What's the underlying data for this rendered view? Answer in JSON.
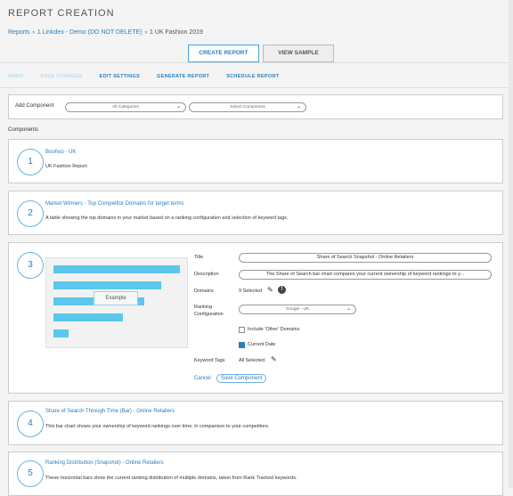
{
  "page": {
    "title": "REPORT CREATION"
  },
  "breadcrumb": {
    "part1": "Reports",
    "part2": "1 Linkdex - Demo (DO NOT DELETE)",
    "part3": "1 UK Fashion 2019"
  },
  "tabs": [
    {
      "label": "CREATE REPORT"
    },
    {
      "label": "VIEW SAMPLE"
    }
  ],
  "toolbar": {
    "undo": "UNDO",
    "save": "SAVE CHANGES",
    "edit": "EDIT SETTINGS",
    "generate": "GENERATE REPORT",
    "schedule": "SCHEDULE REPORT"
  },
  "add_component": {
    "label": "Add Component",
    "categories": "All Categories",
    "components": "Select Component"
  },
  "components_label": "Components",
  "cards": [
    {
      "num": "1",
      "title": "Boohoo - UK",
      "desc": "UK Fashion Report"
    },
    {
      "num": "2",
      "title": "Market Winners - Top Competitor Domains for target terms",
      "desc": "A table showing the top domains in your market based on a ranking configuration and selection of keyword tags."
    },
    {
      "num": "3",
      "example": "Example",
      "form": {
        "title_label": "Title",
        "title_value": "Share of Search Snapshot - Online Retailers",
        "description_label": "Description",
        "description_value": "The Share of Search bar chart compares your current ownership of keyword rankings to y...",
        "domains_label": "Domains",
        "domains_value": "9 Selected",
        "ranking_label_1": "Ranking",
        "ranking_label_2": "Configuration",
        "ranking_value": "Google - UK",
        "include_other": "Include 'Other' Domains",
        "current_date": "Current Date",
        "keyword_label": "Keyword Tags",
        "keyword_value": "All Selected",
        "cancel": "Cancel",
        "save": "Save Component"
      },
      "preview_bars": [
        1.0,
        0.85,
        0.72,
        0.55,
        0.12
      ]
    },
    {
      "num": "4",
      "title": "Share of Search Through Time (Bar) - Online Retailers",
      "desc": "This bar chart shows your ownership of keyword rankings over time, in comparison to your competitors."
    },
    {
      "num": "5",
      "title": "Ranking Distribution (Snapshot) - Online Retailers",
      "desc": "These horizontal bars show the current ranking distribution of multiple domains, taken from Rank Tracked keywords."
    }
  ]
}
